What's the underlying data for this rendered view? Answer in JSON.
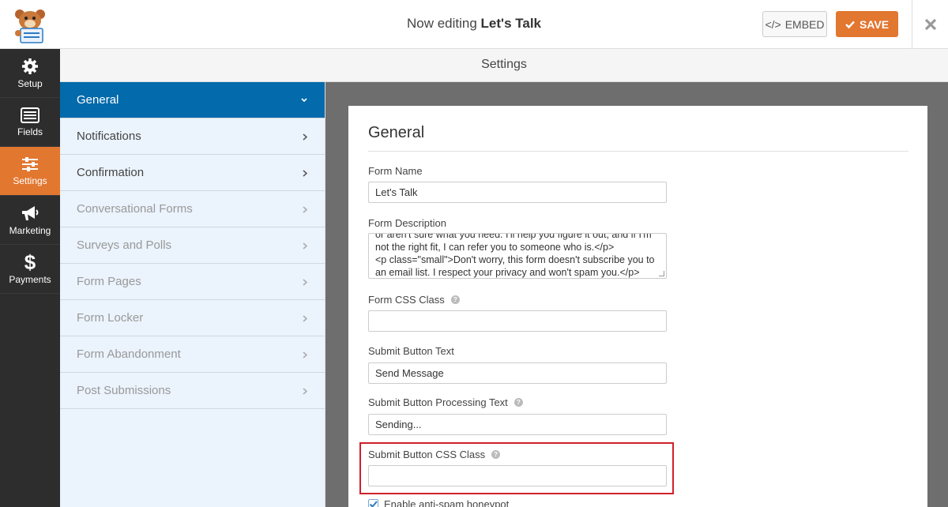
{
  "header": {
    "title_prefix": "Now editing",
    "title_form": "Let's Talk",
    "embed_label": "EMBED",
    "save_label": "SAVE"
  },
  "sidebar": {
    "items": [
      {
        "label": "Setup",
        "icon": "gear-icon"
      },
      {
        "label": "Fields",
        "icon": "list-icon"
      },
      {
        "label": "Settings",
        "icon": "sliders-icon",
        "active": true
      },
      {
        "label": "Marketing",
        "icon": "megaphone-icon"
      },
      {
        "label": "Payments",
        "icon": "dollar-icon"
      }
    ]
  },
  "settings_header": "Settings",
  "nav": {
    "items": [
      {
        "label": "General",
        "active": true
      },
      {
        "label": "Notifications"
      },
      {
        "label": "Confirmation"
      },
      {
        "label": "Conversational Forms",
        "disabled": true
      },
      {
        "label": "Surveys and Polls",
        "disabled": true
      },
      {
        "label": "Form Pages",
        "disabled": true
      },
      {
        "label": "Form Locker",
        "disabled": true
      },
      {
        "label": "Form Abandonment",
        "disabled": true
      },
      {
        "label": "Post Submissions",
        "disabled": true
      }
    ]
  },
  "panel": {
    "title": "General",
    "form_name_label": "Form Name",
    "form_name_value": "Let's Talk",
    "form_desc_label": "Form Description",
    "form_desc_lines": [
      "or aren't sure what you need. I'll help you figure it out, and if I'm",
      "not the right fit, I can refer you to someone who is.</p>",
      "<p class=\"small\">Don't worry, this form doesn't subscribe you to",
      "an email list. I respect your privacy and won't spam you.</p>"
    ],
    "css_class_label": "Form CSS Class",
    "css_class_value": "",
    "submit_text_label": "Submit Button Text",
    "submit_text_value": "Send Message",
    "processing_label": "Submit Button Processing Text",
    "processing_value": "Sending...",
    "submit_css_label": "Submit Button CSS Class",
    "submit_css_value": "",
    "honeypot_label": "Enable anti-spam honeypot"
  },
  "colors": {
    "accent": "#e27730",
    "nav_active": "#036aab",
    "nav_bg": "#ebf3fc",
    "sidebar": "#2d2d2d",
    "highlight": "#d0202a"
  }
}
